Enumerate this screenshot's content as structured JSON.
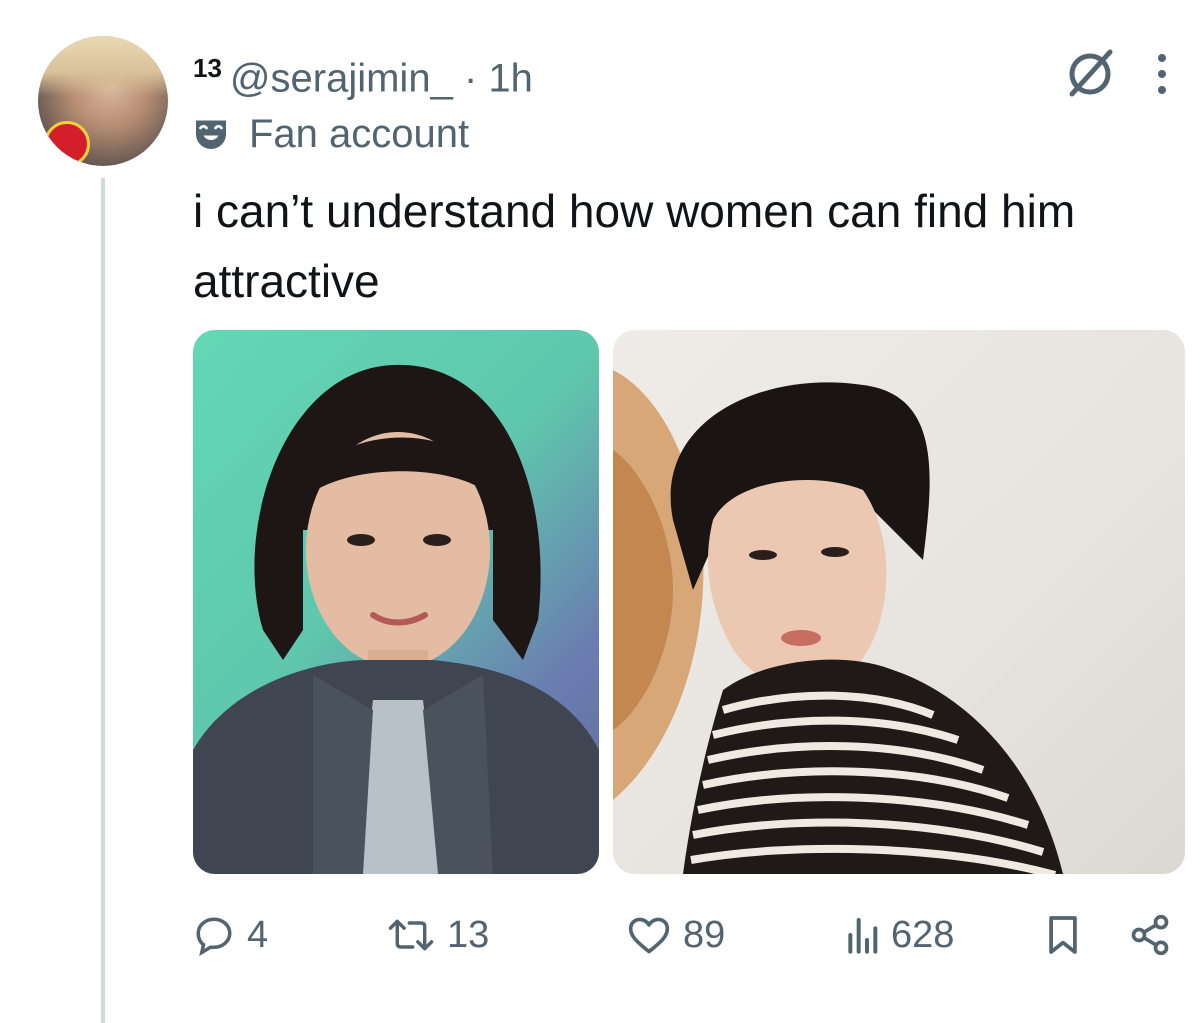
{
  "tweet": {
    "badge_number": "13",
    "handle": "@serajimin_",
    "separator": "·",
    "time": "1h",
    "label": "Fan account",
    "text": "i can’t understand how women can find him attractive"
  },
  "icons": {
    "label_icon": "mask-icon",
    "top_right": [
      "grok-icon",
      "more-options-icon"
    ],
    "actions": [
      "reply-icon",
      "retweet-icon",
      "like-icon",
      "views-icon",
      "bookmark-icon",
      "share-icon"
    ]
  },
  "stats": {
    "replies": "4",
    "retweets": "13",
    "likes": "89",
    "views": "628"
  },
  "colors": {
    "text_primary": "#0f1419",
    "text_secondary": "#536471",
    "thread_line": "#cfd9de"
  }
}
